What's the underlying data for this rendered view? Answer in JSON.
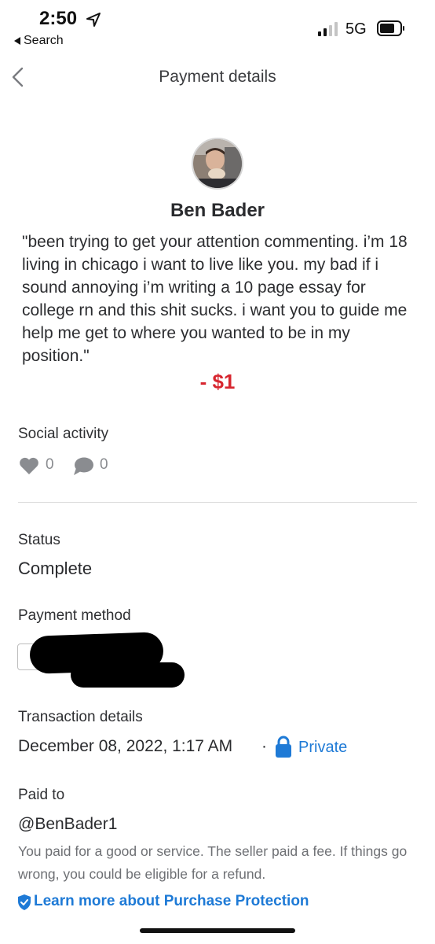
{
  "status_bar": {
    "time": "2:50",
    "back_app": "Search",
    "network": "5G"
  },
  "nav": {
    "title": "Payment details"
  },
  "payment": {
    "name": "Ben Bader",
    "note": "\"been trying to get your attention commenting. i’m 18 living in chicago i want to live like you. my bad if i sound annoying i’m writing a 10 page essay for college rn and this shit sucks. i want you to guide me help me get to where you wanted to be in my position.\"",
    "amount": "- $1",
    "amount_color": "#d7262f"
  },
  "social": {
    "label": "Social activity",
    "likes": "0",
    "comments": "0"
  },
  "status": {
    "label": "Status",
    "value": "Complete"
  },
  "payment_method": {
    "label": "Payment method"
  },
  "transaction": {
    "label": "Transaction details",
    "datetime": "December 08, 2022, 1:17 AM",
    "separator": "·",
    "privacy": "Private"
  },
  "paid_to": {
    "label": "Paid to",
    "handle": "@BenBader1",
    "disclaimer": "You paid for a good or service. The seller paid a fee. If things go wrong, you could be eligible for a refund.",
    "link": "Learn more about Purchase Protection"
  },
  "colors": {
    "accent": "#1e7ad6",
    "icon_gray": "#8a8c90"
  },
  "icons": [
    "location-arrow-icon",
    "signal-icon",
    "battery-icon",
    "chevron-left-icon",
    "heart-icon",
    "comment-icon",
    "lock-icon",
    "shield-check-icon"
  ]
}
